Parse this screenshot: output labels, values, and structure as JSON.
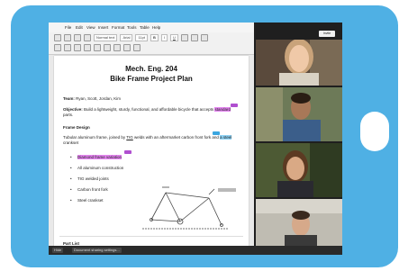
{
  "menu": [
    "File",
    "Edit",
    "View",
    "Insert",
    "Format",
    "Tools",
    "Table",
    "Help"
  ],
  "toolbar": {
    "style": "Normal text",
    "font": "Arial",
    "size": "11pt",
    "bold": "B",
    "italic": "I",
    "underline": "U"
  },
  "doc": {
    "title_line1": "Mech. Eng. 204",
    "title_line2": "Bike Frame Project Plan",
    "team_label": "Team:",
    "team_value": " Ryan, Scott, Jordan, Kim",
    "objective_label": "Objective:",
    "objective_text": " Build a lightweight, sturdy, functional, and affordable bicycle that accepts ",
    "objective_hl": "standard",
    "objective_end": "parts.",
    "frame_heading": "Frame Design",
    "frame_text_1": "Tubular aluminum frame, joined by ",
    "frame_text_tig": "TIG",
    "frame_text_2": " welds with an aftermarket carbon front fork and ",
    "frame_text_hl": "a steel",
    "frame_text_3": "crankset",
    "bullets": [
      "Diamond frame variation",
      "All aluminum construction",
      "TIG welded joints",
      "Carbon front fork",
      "Steel crankset"
    ],
    "part_list": "Part List",
    "axles": "Axles"
  },
  "bottom": {
    "item1": "Hide",
    "item2": "Document sharing settings..."
  },
  "hangout": {
    "button": "Invite"
  },
  "colors": {
    "background_blue": "#4fb0e4",
    "highlight_purple": "#e486f0",
    "highlight_blue": "#8fd3f5"
  }
}
